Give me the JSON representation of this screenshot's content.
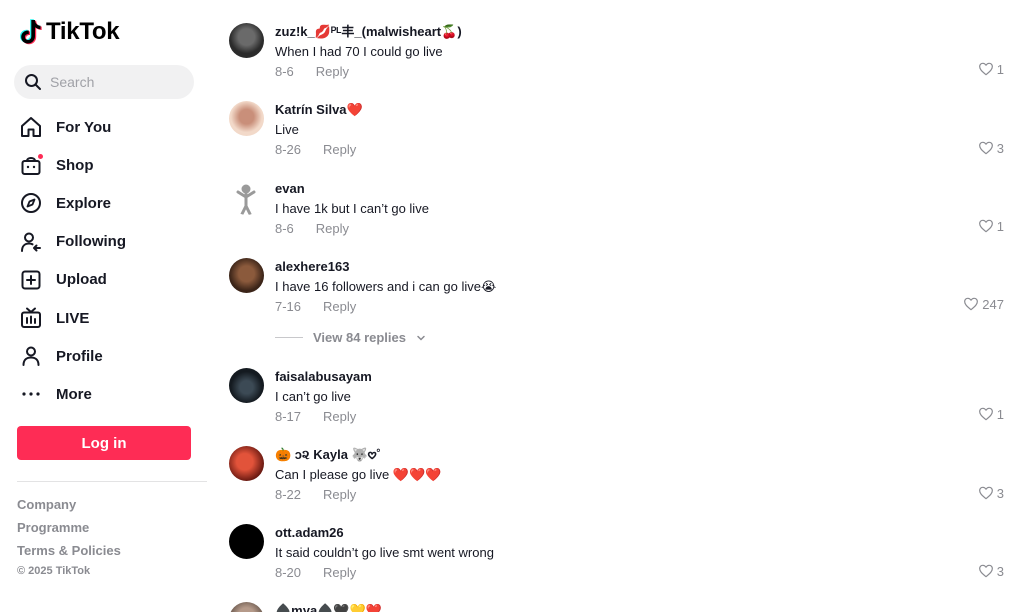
{
  "app": {
    "name": "TikTok"
  },
  "search": {
    "placeholder": "Search"
  },
  "nav": [
    {
      "label": "For You",
      "icon": "home-icon"
    },
    {
      "label": "Shop",
      "icon": "shop-icon"
    },
    {
      "label": "Explore",
      "icon": "compass-icon"
    },
    {
      "label": "Following",
      "icon": "following-icon"
    },
    {
      "label": "Upload",
      "icon": "upload-icon"
    },
    {
      "label": "LIVE",
      "icon": "live-icon"
    },
    {
      "label": "Profile",
      "icon": "profile-icon"
    },
    {
      "label": "More",
      "icon": "more-icon"
    }
  ],
  "login": {
    "label": "Log in"
  },
  "footer": {
    "links": [
      "Company",
      "Programme",
      "Terms & Policies"
    ],
    "copyright": "© 2025 TikTok"
  },
  "comments": [
    {
      "user": "zuz!k_💋ᴾᴸ丰_(malwisheart🍒)",
      "text": "When I had 70 I could go live",
      "date": "8-6",
      "reply": "Reply",
      "likes": "1"
    },
    {
      "user": "Katrín Silva❤️",
      "text": "Live",
      "date": "8-26",
      "reply": "Reply",
      "likes": "3"
    },
    {
      "user": "evan",
      "text": "I have 1k but I can’t go live",
      "date": "8-6",
      "reply": "Reply",
      "likes": "1"
    },
    {
      "user": "alexhere163",
      "text": "I have 16 followers and i can go live😭",
      "date": "7-16",
      "reply": "Reply",
      "likes": "247",
      "view_replies": "View 84 replies"
    },
    {
      "user": "faisalabusayam",
      "text": "I can’t go live",
      "date": "8-17",
      "reply": "Reply",
      "likes": "1"
    },
    {
      "user": "🎃 ɔ૨ Kayla 🐺𖹭˚",
      "text": "Can I please go live ❤️❤️❤️",
      "date": "8-22",
      "reply": "Reply",
      "likes": "3"
    },
    {
      "user": "ott.adam26",
      "text": "It said couldn’t go live smt went wrong",
      "date": "8-20",
      "reply": "Reply",
      "likes": "3"
    },
    {
      "user": "♠️mya♠️🖤💛❤️",
      "text": "",
      "date": "",
      "reply": "",
      "likes": ""
    }
  ],
  "colors": {
    "accent": "#fe2c55",
    "text": "#161823",
    "muted": "#8a8b91"
  }
}
